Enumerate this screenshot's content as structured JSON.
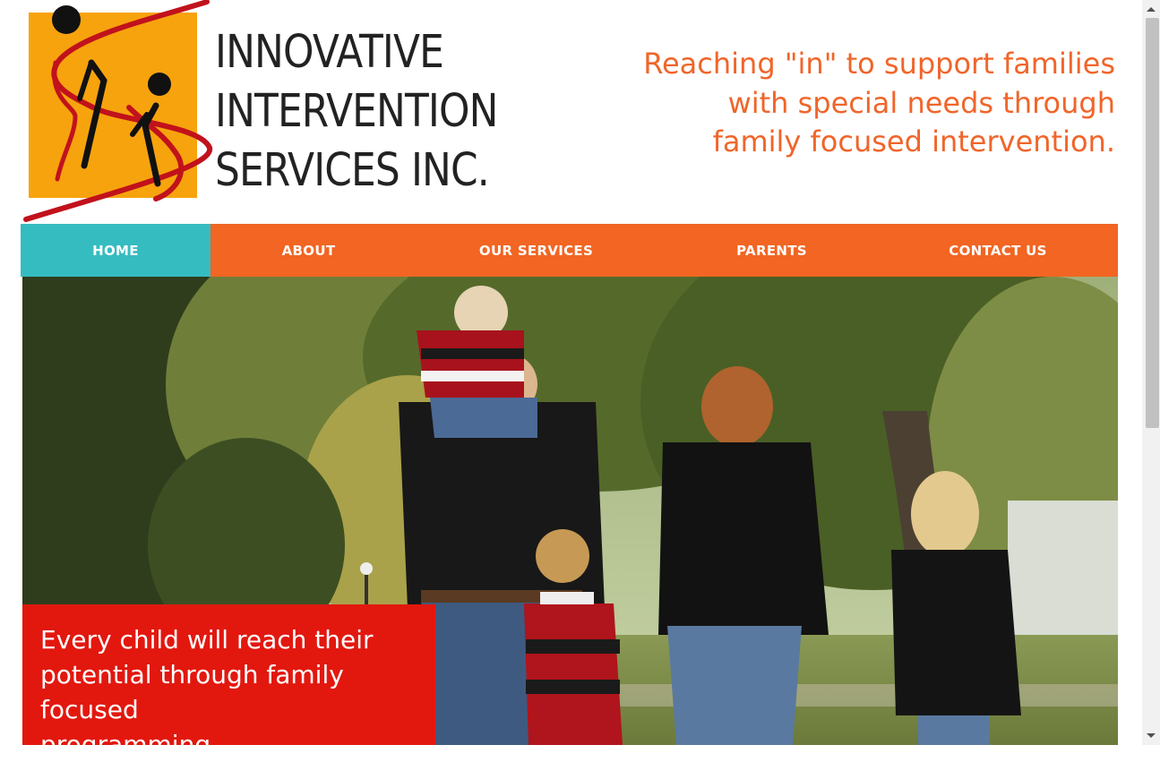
{
  "logo": {
    "lines": [
      "INNOVATIVE",
      "INTERVENTION",
      "SERVICES INC."
    ]
  },
  "tagline": {
    "lines": [
      "Reaching \"in\" to support families",
      "with special needs through",
      "family focused intervention."
    ]
  },
  "nav": {
    "items": [
      {
        "label": "HOME"
      },
      {
        "label": "ABOUT"
      },
      {
        "label": "OUR SERVICES"
      },
      {
        "label": "PARENTS"
      },
      {
        "label": "CONTACT US"
      }
    ]
  },
  "hero": {
    "mission_lines": [
      "Every child will reach their",
      "potential through family focused",
      "programming."
    ]
  },
  "colors": {
    "nav_orange": "#f26522",
    "nav_active_teal": "#35bcc1",
    "tagline_orange": "#f0652a",
    "mission_red": "#e2180f",
    "logo_orange": "#f7a30d",
    "logo_red": "#c1121c"
  }
}
